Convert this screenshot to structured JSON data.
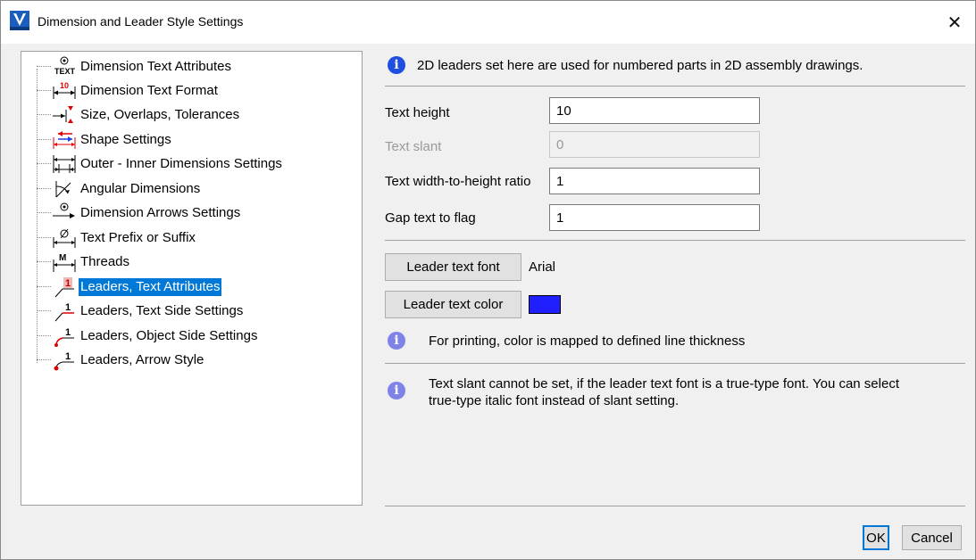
{
  "window": {
    "title": "Dimension and Leader Style Settings",
    "close_glyph": "✕",
    "app_icon_name": "vericut-app-icon"
  },
  "tree": {
    "items": [
      {
        "label": "Dimension Text Attributes",
        "icon": "text-attributes-icon"
      },
      {
        "label": "Dimension Text Format",
        "icon": "text-format-icon"
      },
      {
        "label": "Size, Overlaps, Tolerances",
        "icon": "tolerances-icon"
      },
      {
        "label": "Shape Settings",
        "icon": "shape-settings-icon"
      },
      {
        "label": "Outer - Inner Dimensions Settings",
        "icon": "outer-inner-icon"
      },
      {
        "label": "Angular Dimensions",
        "icon": "angular-icon"
      },
      {
        "label": "Dimension Arrows Settings",
        "icon": "arrows-icon"
      },
      {
        "label": "Text Prefix or Suffix",
        "icon": "prefix-suffix-icon"
      },
      {
        "label": "Threads",
        "icon": "threads-icon"
      },
      {
        "label": "Leaders, Text Attributes",
        "icon": "leader-text-attr-icon",
        "selected": true
      },
      {
        "label": "Leaders, Text Side Settings",
        "icon": "leader-text-side-icon"
      },
      {
        "label": "Leaders, Object Side Settings",
        "icon": "leader-object-side-icon"
      },
      {
        "label": "Leaders, Arrow Style",
        "icon": "leader-arrow-style-icon"
      }
    ],
    "selected_index": 9
  },
  "panel": {
    "top_info": "2D leaders set here are used for numbered parts in 2D assembly drawings.",
    "fields": {
      "text_height": {
        "label": "Text height",
        "value": "10"
      },
      "text_slant": {
        "label": "Text slant",
        "value": "0",
        "disabled": true
      },
      "width_ratio": {
        "label": "Text width-to-height ratio",
        "value": "1"
      },
      "gap": {
        "label": "Gap text to flag",
        "value": "1"
      }
    },
    "font_button": "Leader text font",
    "font_value": "Arial",
    "color_button": "Leader text color",
    "color_value": "#1f1fff",
    "color_info": "For printing, color is mapped to defined line thickness",
    "slant_info_line1": "Text slant cannot be set, if the leader text font is a true-type font. You can select",
    "slant_info_line2": "true-type italic font instead of slant setting."
  },
  "footer": {
    "ok": "OK",
    "cancel": "Cancel"
  },
  "colors": {
    "selection": "#0078d7",
    "info_strong": "#1e4fe0",
    "info_soft": "#7f83e8"
  }
}
